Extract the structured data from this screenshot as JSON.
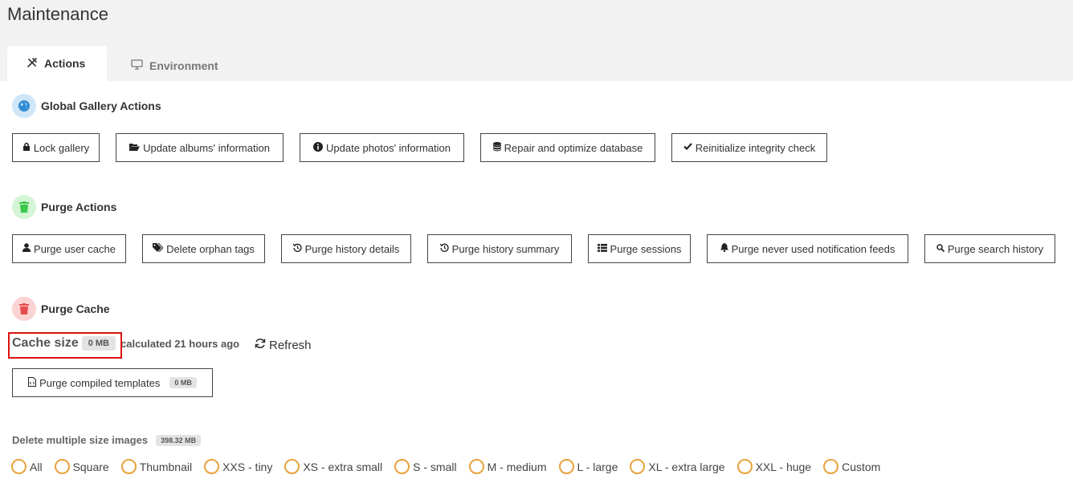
{
  "page": {
    "title": "Maintenance"
  },
  "tabs": [
    {
      "label": "Actions",
      "icon": "tools-icon",
      "active": true
    },
    {
      "label": "Environment",
      "icon": "monitor-icon",
      "active": false
    }
  ],
  "global_actions": {
    "title": "Global Gallery Actions",
    "icon": "globe-icon",
    "buttons": [
      {
        "label": "Lock gallery",
        "icon": "lock-icon"
      },
      {
        "label": "Update albums' information",
        "icon": "folder-open-icon"
      },
      {
        "label": "Update photos' information",
        "icon": "info-icon"
      },
      {
        "label": "Repair and optimize database",
        "icon": "database-icon"
      },
      {
        "label": "Reinitialize integrity check",
        "icon": "check-icon"
      }
    ]
  },
  "purge_actions": {
    "title": "Purge Actions",
    "icon": "trash-icon",
    "buttons": [
      {
        "label": "Purge user cache",
        "icon": "user-icon"
      },
      {
        "label": "Delete orphan tags",
        "icon": "tags-icon"
      },
      {
        "label": "Purge history details",
        "icon": "history-icon"
      },
      {
        "label": "Purge history summary",
        "icon": "history-icon"
      },
      {
        "label": "Purge sessions",
        "icon": "list-icon"
      },
      {
        "label": "Purge never used notification feeds",
        "icon": "bell-icon"
      },
      {
        "label": "Purge search history",
        "icon": "search-icon"
      }
    ]
  },
  "purge_cache": {
    "title": "Purge Cache",
    "icon": "trash-icon",
    "cache_size_label": "Cache size",
    "cache_size_value": "0 MB",
    "calculated": "calculated 21 hours ago",
    "refresh_label": "Refresh",
    "compiled_button_label": "Purge compiled templates",
    "compiled_button_badge": "0 MB"
  },
  "delete_sizes": {
    "label": "Delete multiple size images",
    "badge": "398.32 MB",
    "options": [
      "All",
      "Square",
      "Thumbnail",
      "XXS - tiny",
      "XS - extra small",
      "S - small",
      "M - medium",
      "L - large",
      "XL - extra large",
      "XXL - huge",
      "Custom"
    ]
  },
  "colors": {
    "accent_radio": "#e9a23b",
    "highlight": "#dd1111",
    "globe": "#2f8bd6",
    "green_trash": "#3cc84a",
    "red_trash": "#e84d4d"
  }
}
